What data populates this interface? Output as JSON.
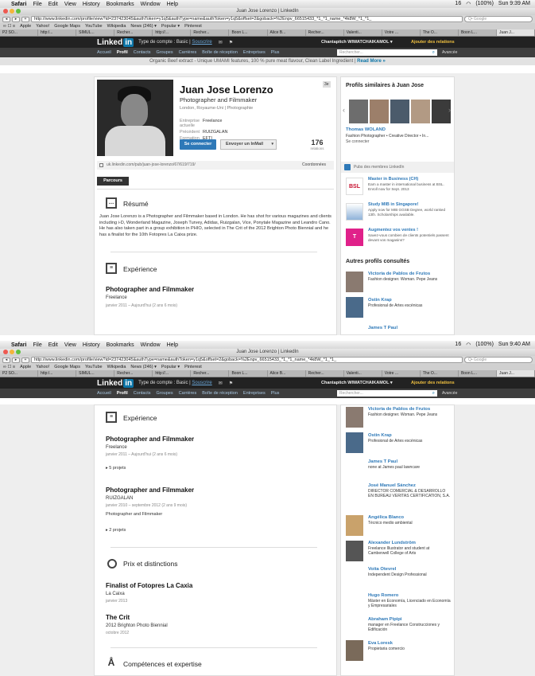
{
  "browser": {
    "menubar": {
      "app": "Safari",
      "items": [
        "File",
        "Edit",
        "View",
        "History",
        "Bookmarks",
        "Window",
        "Help"
      ],
      "status": "16",
      "battery": "(100%)"
    },
    "window_title": "Juan Jose Lorenzo | LinkedIn",
    "url_top": "http://www.linkedin.com/profile/view?id=237423045&authToken=y1q5&authType=name&authToken=y1q5&offset=2&goback=%2Enpv_66515433_*1_*1_name_*4k8W_*1_*1_",
    "url_bottom": "http://www.linkedin.com/profile/view?id=237423045&authType=name&authToken=y1q5&offset=2&goback=%2Enpv_66515433_*1_*1_name_*4k8W_*1_*1_",
    "google_placeholder": "Q• Google",
    "bookmarks": [
      "Apple",
      "Yahoo!",
      "Google Maps",
      "YouTube",
      "Wikipedia",
      "News (246) ▾",
      "Popular ▾",
      "Pinterest"
    ],
    "tabs": [
      "P2 SO...",
      "http:/...",
      "SIMUL...",
      "Recher...",
      "http://...",
      "Recher...",
      "Boon L...",
      "Alice B...",
      "Recher...",
      "Valenti...",
      "Votre ...",
      "The O...",
      "Boon L...",
      "Juan J..."
    ],
    "clock_top": "Sun 9:39 AM",
    "clock_bottom": "Sun 9:40 AM"
  },
  "linkedin": {
    "logo_text": "Linked",
    "logo_in": "in",
    "account_type": "Type de compte : Basic |",
    "upgrade": "Souscrire",
    "user": "Chantapitch WIWATCHAIKAMOL ▾",
    "add_connections": "Ajouter des relations",
    "nav": [
      "Accueil",
      "Profil",
      "Contacts",
      "Groupes",
      "Carrières",
      "Boîte de réception",
      "Entreprises",
      "Plus"
    ],
    "search_placeholder": "Rechercher...",
    "advanced": "Avancée",
    "promo_text": "Organic Beef extract - Unique UMAMI features, 100 % pure meat flavour, Clean Label Ingredient |",
    "promo_link": "Read More »"
  },
  "profile": {
    "name": "Juan Jose Lorenzo",
    "headline": "Photographer and Filmmaker",
    "location": "London, Royaume-Uni | Photographie",
    "degree": "3e",
    "facts": [
      {
        "k": "Entreprise actuelle",
        "v": "Freelance"
      },
      {
        "k": "Précédent",
        "v": "RUIZGALAN"
      },
      {
        "k": "Formation",
        "v": "EFTI"
      }
    ],
    "connect_label": "Se connecter",
    "inmail_label": "Envoyer un InMail",
    "connections_count": "176",
    "connections_label": "relations",
    "public_url": "uk.linkedin.com/pub/juan-jose-lorenzo/67/619/719/",
    "coordinates_label": "Coordonnées",
    "parcours_label": "Parcours",
    "summary_title": "Résumé",
    "summary_text": "Juan Jose Lorenzo is a Photographer and Filmmaker based in London. He has shot for various magazines and clients including i-D, Wonderland Magazine, Joseph Turvey, Adidas, Ruizgalan, Vice, Ponytale Magazine and Leandro Cano. He has also taken part in a group exhibition in PHIO, selected in The Crit of the 2012 Brighton Photo Biennial and he has a finalist for the 10th Fotopres La Caixa prize.",
    "experience_title": "Expérience",
    "jobs": [
      {
        "title": "Photographer and Filmmaker",
        "company": "Freelance",
        "dates": "janvier 2011 – Aujourd'hui (2 ans 6 mois)",
        "projects": "▸ 5 projets",
        "desc": ""
      },
      {
        "title": "Photographer and Filmmaker",
        "company": "RUIZGALAN",
        "dates": "janvier 2010 – septembre 2012 (2 ans 9 mois)",
        "projects": "▸ 2 projets",
        "desc": "Photographer and Filmmaker"
      }
    ],
    "awards_title": "Prix et distinctions",
    "awards": [
      {
        "title": "Finalist of Fotopres La Caxia",
        "org": "La Caixa",
        "date": "janvier 2013"
      },
      {
        "title": "The Crit",
        "org": "2012 Brighton Photo Biennial",
        "date": "octobre 2012"
      }
    ],
    "skills_title": "Compétences et expertise"
  },
  "sidebar": {
    "similar_title": "Profils similaires à Juan Jose",
    "similar_name": "Thomas WOLAND",
    "similar_desc": "Fashion Photographer • Creative Director • In...",
    "similar_connect": "Se connecter",
    "ads_header": "Pubs des membres LinkedIn",
    "ads": [
      {
        "logo": "BSL",
        "title": "Master in Business (CH)",
        "text": "Earn a master in international business at BSL. Enroll now for Sept. 2013",
        "color": "#c8102e"
      },
      {
        "logo": "",
        "title": "Study MIB in Singapore!",
        "text": "Apply now for MIB GGSB Degree, world ranked 13th. Scholarships available.",
        "color": "#2e79b8"
      },
      {
        "logo": "T",
        "title": "Augmentez vos ventes !",
        "text": "Savez-vous combien de clients potentiels passent devant vos magasins?",
        "color": "#e0218a"
      }
    ],
    "viewed_title": "Autres profils consultés",
    "viewed": [
      {
        "name": "Victoria de Pablos de Frutos",
        "desc": "Fashion designer. Woman. Pepe Jeans"
      },
      {
        "name": "Ostin Krap",
        "desc": "Profesional de Artes escénicas"
      },
      {
        "name": "James T Paul",
        "desc": "none at James paul lawncare"
      },
      {
        "name": "José Manuel Sánchez",
        "desc": "DIRECTOR COMERCIAL & DESARROLLO EN BUREAU VERITAS CERTIFICATION, S.A."
      },
      {
        "name": "Angélica Blanco",
        "desc": "Técnico medio ambiental"
      },
      {
        "name": "Alexander Lundström",
        "desc": "Freelance Illustrator and student at Camberwell College of Arts"
      },
      {
        "name": "Voita Otevrel",
        "desc": "Independent Design Professional"
      },
      {
        "name": "Hugo Romero",
        "desc": "Máster en Economía, Licenciado en Economía y Empresariales"
      },
      {
        "name": "Abraham Pipipi",
        "desc": "manager en Freelance Construcciones y Edificación"
      },
      {
        "name": "Eva Loresk",
        "desc": "Propietaria comercio"
      }
    ]
  }
}
